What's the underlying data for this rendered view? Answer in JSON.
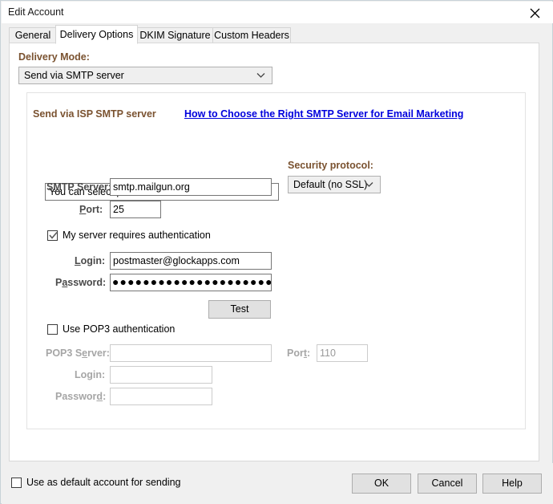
{
  "window": {
    "title": "Edit Account",
    "close_icon": "close-icon"
  },
  "tabs": [
    {
      "label": "General",
      "selected": false
    },
    {
      "label": "Delivery Options",
      "selected": true
    },
    {
      "label": "DKIM Signature",
      "selected": false
    },
    {
      "label": "Custom Headers",
      "selected": false
    }
  ],
  "delivery": {
    "mode_label": "Delivery Mode:",
    "mode_value": "Send via SMTP server"
  },
  "group": {
    "title": "Send via ISP SMTP server",
    "link_text": "How to Choose the Right SMTP Server for Email Marketing",
    "predefined_value": "You can select predefined SMTP servers",
    "smtp_server_label": "SMTP Server:",
    "smtp_server_value": "smtp.mailgun.org",
    "port_label": "Port:",
    "port_value": "25",
    "security_label": "Security protocol:",
    "security_value": "Default (no SSL)",
    "auth_checkbox_label": "My server requires authentication",
    "auth_checked": true,
    "login_label": "Login:",
    "login_value": "postmaster@glockapps.com",
    "password_label": "Password:",
    "password_value": "●●●●●●●●●●●●●●●●●●●●●●",
    "test_button": "Test",
    "pop3_checkbox_label": "Use POP3 authentication",
    "pop3_checked": false,
    "pop3_server_label": "POP3 Server:",
    "pop3_server_value": "",
    "pop3_port_label": "Port:",
    "pop3_port_value": "110",
    "pop3_login_label": "Login:",
    "pop3_login_value": "",
    "pop3_password_label": "Password:",
    "pop3_password_value": ""
  },
  "footer": {
    "default_account_label": "Use as default account for sending",
    "default_account_checked": false,
    "ok_label": "OK",
    "cancel_label": "Cancel",
    "help_label": "Help"
  },
  "colors": {
    "group_title": "#7a5230",
    "link": "#0000dd",
    "field_label": "#4a4a4a",
    "disabled_label": "#a6a6a6",
    "window_bg": "#f0f0f0",
    "panel_bg": "#ffffff"
  }
}
